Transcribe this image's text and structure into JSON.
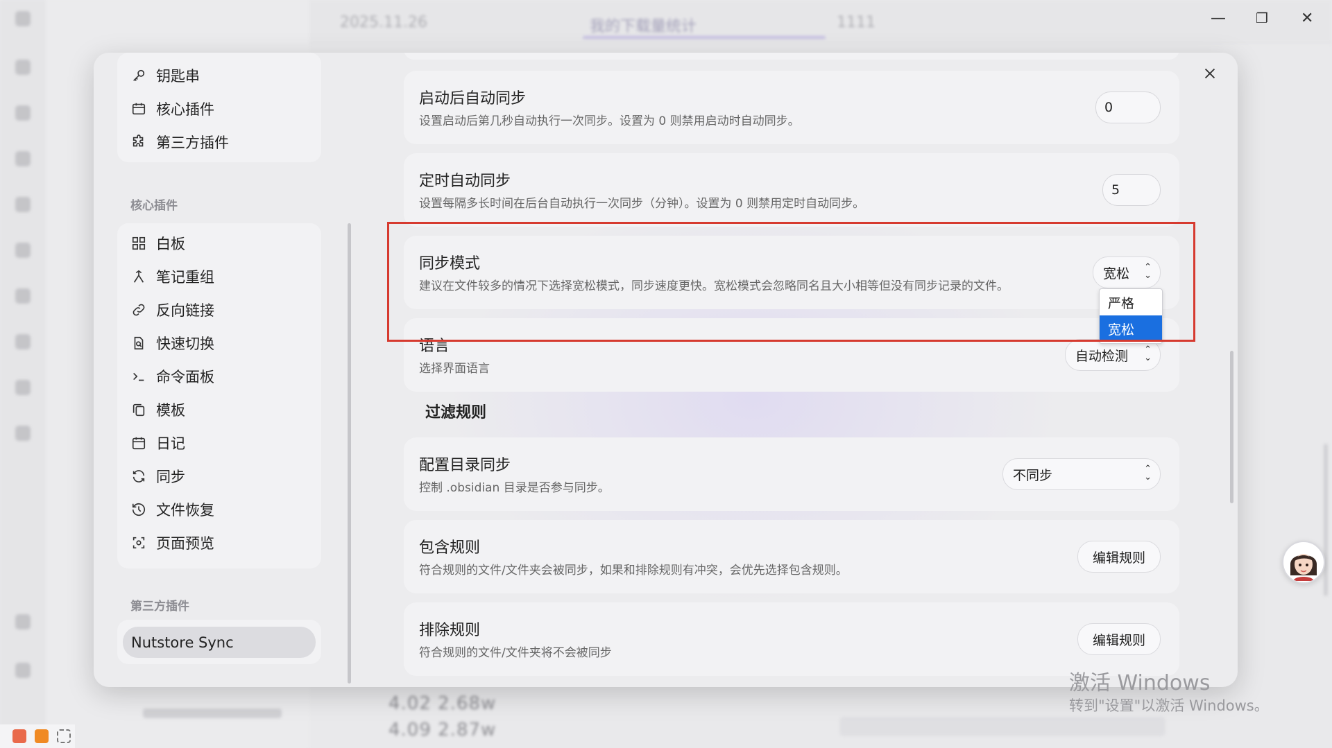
{
  "background": {
    "tabs": [
      "2025.11.26",
      "我的下载量统计",
      "1111"
    ],
    "bottom_rows": [
      "4.02 2.68w",
      "4.09 2.87w"
    ]
  },
  "settings": {
    "nav": {
      "top_items": [
        {
          "label": "钥匙串",
          "icon": "key-icon"
        },
        {
          "label": "核心插件",
          "icon": "calendar-box-icon"
        },
        {
          "label": "第三方插件",
          "icon": "puzzle-icon"
        }
      ],
      "core_heading": "核心插件",
      "core_items": [
        {
          "label": "白板",
          "icon": "grid-icon"
        },
        {
          "label": "笔记重组",
          "icon": "merge-icon"
        },
        {
          "label": "反向链接",
          "icon": "backlink-icon"
        },
        {
          "label": "快速切换",
          "icon": "file-search-icon"
        },
        {
          "label": "命令面板",
          "icon": "terminal-icon"
        },
        {
          "label": "模板",
          "icon": "copy-icon"
        },
        {
          "label": "日记",
          "icon": "calendar-icon"
        },
        {
          "label": "同步",
          "icon": "sync-icon"
        },
        {
          "label": "文件恢复",
          "icon": "history-icon"
        },
        {
          "label": "页面预览",
          "icon": "preview-icon"
        }
      ],
      "third_party_heading": "第三方插件",
      "selected_plugin": "Nutstore Sync"
    },
    "rows": {
      "startup_sync": {
        "title": "启动后自动同步",
        "desc": "设置启动后第几秒自动执行一次同步。设置为 0 则禁用启动时自动同步。",
        "value": "0"
      },
      "interval_sync": {
        "title": "定时自动同步",
        "desc": "设置每隔多长时间在后台自动执行一次同步（分钟）。设置为 0 则禁用定时自动同步。",
        "value": "5"
      },
      "sync_mode": {
        "title": "同步模式",
        "desc": "建议在文件较多的情况下选择宽松模式，同步速度更快。宽松模式会忽略同名且大小相等但没有同步记录的文件。",
        "value": "宽松",
        "options": [
          "严格",
          "宽松"
        ]
      },
      "language": {
        "title": "语言",
        "desc": "选择界面语言",
        "value": "自动检测"
      },
      "filter_heading": "过滤规则",
      "config_sync": {
        "title": "配置目录同步",
        "desc": "控制 .obsidian 目录是否参与同步。",
        "value": "不同步"
      },
      "include_rules": {
        "title": "包含规则",
        "desc": "符合规则的文件/文件夹会被同步，如果和排除规则有冲突，会优先选择包含规则。",
        "button": "编辑规则"
      },
      "exclude_rules": {
        "title": "排除规则",
        "desc": "符合规则的文件/文件夹将不会被同步",
        "button": "编辑规则"
      }
    }
  },
  "watermark": {
    "line1": "激活 Windows",
    "line2": "转到\"设置\"以激活 Windows。"
  },
  "colors": {
    "highlight": "#d63a2f",
    "selected_option": "#1a6fe0",
    "accent": "#b7afde"
  }
}
